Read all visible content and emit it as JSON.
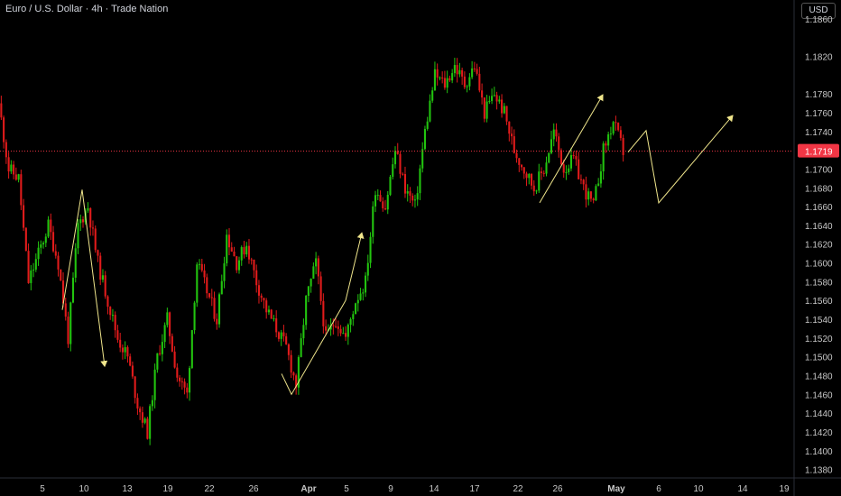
{
  "header": {
    "title": "Euro / U.S. Dollar · 4h · Trade Nation",
    "currency_label": "USD"
  },
  "colors": {
    "background": "#000000",
    "up": "#22c40f",
    "down": "#e11b1b",
    "projection": "#f0e68c",
    "price_label_bg": "#f23645",
    "axis_text": "#c7c7c7",
    "grid": "#111111"
  },
  "chart_data": {
    "type": "candlestick",
    "x_tick_labels": [
      "5",
      "10",
      "13",
      "19",
      "22",
      "26",
      "Apr",
      "5",
      "9",
      "14",
      "17",
      "22",
      "26",
      "May",
      "6",
      "10",
      "14",
      "19"
    ],
    "y_ticks": [
      1.138,
      1.14,
      1.142,
      1.144,
      1.146,
      1.148,
      1.15,
      1.152,
      1.154,
      1.156,
      1.158,
      1.16,
      1.162,
      1.164,
      1.166,
      1.168,
      1.17,
      1.174,
      1.176,
      1.178,
      1.182,
      1.186
    ],
    "ylim": [
      1.1372,
      1.188
    ],
    "current_price": 1.1719,
    "current_price_label": "1.1719",
    "close_path": [
      [
        0,
        1.177
      ],
      [
        2,
        1.17
      ],
      [
        4,
        1.169
      ],
      [
        6,
        1.158
      ],
      [
        8,
        1.161
      ],
      [
        10,
        1.164
      ],
      [
        12,
        1.16
      ],
      [
        14,
        1.152
      ],
      [
        16,
        1.164
      ],
      [
        18,
        1.166
      ],
      [
        20,
        1.16
      ],
      [
        22,
        1.156
      ],
      [
        24,
        1.152
      ],
      [
        26,
        1.15
      ],
      [
        28,
        1.145
      ],
      [
        30,
        1.142
      ],
      [
        32,
        1.15
      ],
      [
        34,
        1.154
      ],
      [
        36,
        1.148
      ],
      [
        38,
        1.146
      ],
      [
        40,
        1.16
      ],
      [
        42,
        1.157
      ],
      [
        44,
        1.154
      ],
      [
        46,
        1.163
      ],
      [
        48,
        1.16
      ],
      [
        50,
        1.162
      ],
      [
        52,
        1.158
      ],
      [
        54,
        1.155
      ],
      [
        56,
        1.153
      ],
      [
        58,
        1.151
      ],
      [
        60,
        1.147
      ],
      [
        62,
        1.156
      ],
      [
        64,
        1.16
      ],
      [
        66,
        1.152
      ],
      [
        68,
        1.154
      ],
      [
        70,
        1.152
      ],
      [
        72,
        1.156
      ],
      [
        74,
        1.158
      ],
      [
        76,
        1.168
      ],
      [
        78,
        1.166
      ],
      [
        80,
        1.172
      ],
      [
        82,
        1.168
      ],
      [
        84,
        1.166
      ],
      [
        86,
        1.174
      ],
      [
        88,
        1.18
      ],
      [
        90,
        1.179
      ],
      [
        92,
        1.181
      ],
      [
        94,
        1.179
      ],
      [
        96,
        1.181
      ],
      [
        98,
        1.176
      ],
      [
        100,
        1.178
      ],
      [
        102,
        1.176
      ],
      [
        104,
        1.172
      ],
      [
        106,
        1.17
      ],
      [
        108,
        1.168
      ],
      [
        110,
        1.17
      ],
      [
        112,
        1.174
      ],
      [
        114,
        1.17
      ],
      [
        116,
        1.171
      ],
      [
        118,
        1.168
      ],
      [
        120,
        1.166
      ],
      [
        122,
        1.172
      ],
      [
        124,
        1.175
      ],
      [
        126,
        1.1719
      ]
    ],
    "projections": [
      [
        [
          69,
          1.155
        ],
        [
          91,
          1.1678
        ],
        [
          116,
          1.149
        ]
      ],
      [
        [
          312,
          1.1482
        ],
        [
          323,
          1.146
        ],
        [
          383,
          1.156
        ],
        [
          401,
          1.1632
        ]
      ],
      [
        [
          598,
          1.1664
        ],
        [
          668,
          1.1779
        ]
      ],
      [
        [
          696,
          1.1718
        ],
        [
          716,
          1.1741
        ],
        [
          730,
          1.1664
        ],
        [
          812,
          1.1757
        ]
      ]
    ]
  }
}
